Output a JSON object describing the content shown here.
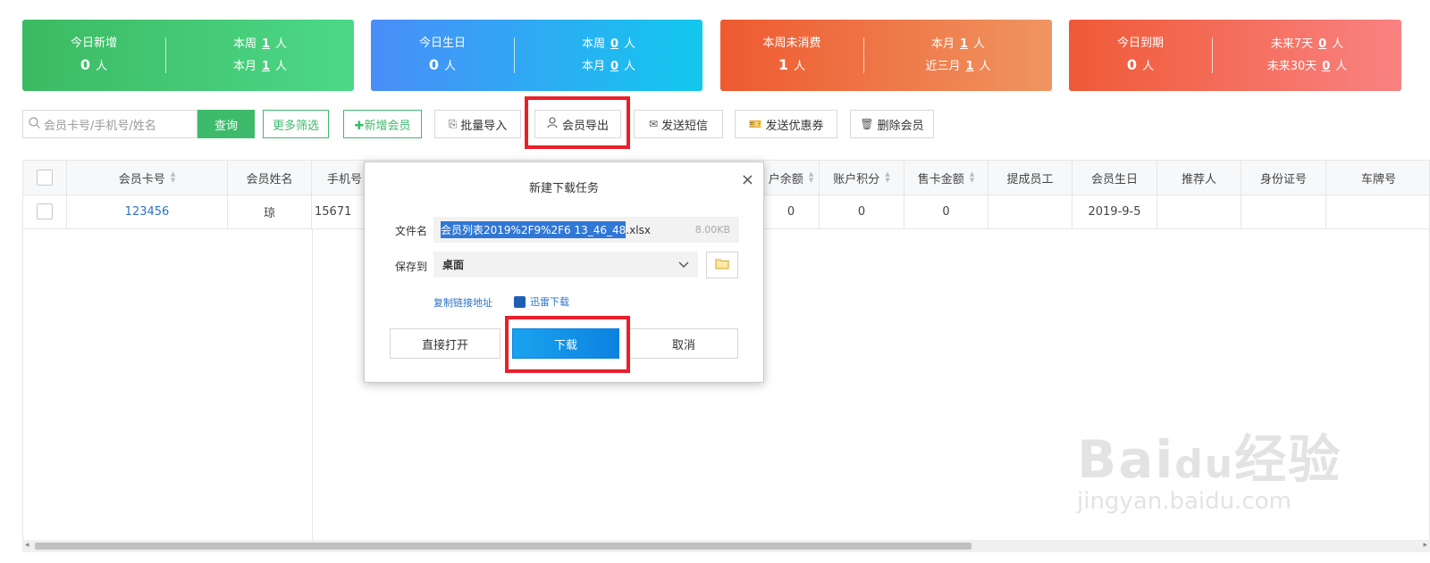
{
  "stats": [
    {
      "title": "今日新增",
      "value": "0",
      "unit": "人",
      "r1_label": "本周",
      "r1_value": "1",
      "r1_unit": "人",
      "r2_label": "本月",
      "r2_value": "1",
      "r2_unit": "人"
    },
    {
      "title": "今日生日",
      "value": "0",
      "unit": "人",
      "r1_label": "本周",
      "r1_value": "0",
      "r1_unit": "人",
      "r2_label": "本月",
      "r2_value": "0",
      "r2_unit": "人"
    },
    {
      "title": "本周未消费",
      "value": "1",
      "unit": "人",
      "r1_label": "本月",
      "r1_value": "1",
      "r1_unit": "人",
      "r2_label": "近三月",
      "r2_value": "1",
      "r2_unit": "人"
    },
    {
      "title": "今日到期",
      "value": "0",
      "unit": "人",
      "r1_label": "未来7天",
      "r1_value": "0",
      "r1_unit": "人",
      "r2_label": "未来30天",
      "r2_value": "0",
      "r2_unit": "人"
    }
  ],
  "toolbar": {
    "search_placeholder": "会员卡号/手机号/姓名",
    "query": "查询",
    "more_filter": "更多筛选",
    "add_member": "✚新增会员",
    "batch_import": "批量导入",
    "export_member": "会员导出",
    "send_sms": "发送短信",
    "send_coupon": "发送优惠券",
    "delete_member": "删除会员"
  },
  "table": {
    "headers": [
      "会员卡号",
      "会员姓名",
      "手机号",
      "户余额",
      "账户积分",
      "售卡金额",
      "提成员工",
      "会员生日",
      "推荐人",
      "身份证号",
      "车牌号"
    ],
    "row": {
      "card": "123456",
      "name": "琼",
      "phone": "15671",
      "balance": "0",
      "points": "0",
      "card_amount": "0",
      "staff": "",
      "birthday": "2019-9-5",
      "referrer": "",
      "id_no": "",
      "plate": ""
    }
  },
  "dialog": {
    "title": "新建下载任务",
    "filename_label": "文件名",
    "filename_selected": "会员列表2019%2F9%2F6 13_46_48",
    "filename_ext": ".xlsx",
    "filesize": "8.00KB",
    "saveto_label": "保存到",
    "saveto_value": "桌面",
    "copy_link": "复制链接地址",
    "thunder": "迅雷下载",
    "open_direct": "直接打开",
    "download": "下载",
    "cancel": "取消"
  },
  "watermark": {
    "brand": "Bai",
    "brand2": "经验",
    "sub": "jingyan.baidu.com"
  }
}
